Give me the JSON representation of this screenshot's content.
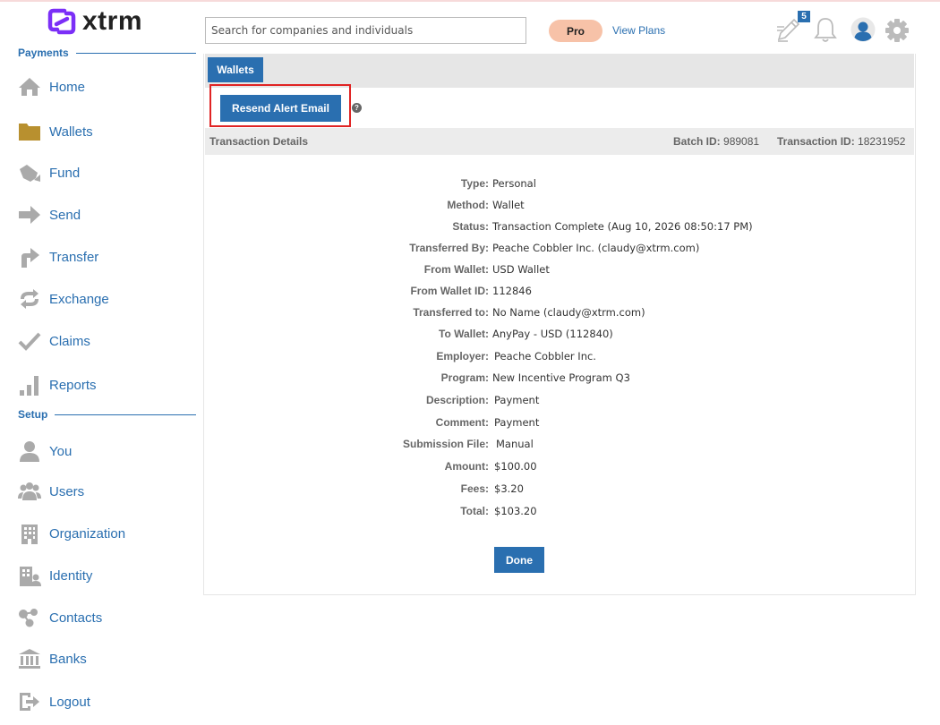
{
  "app": {
    "brand": "xtrm",
    "brand_color": "#7b2ff7",
    "accent_color": "#2a6fb0"
  },
  "header": {
    "search_placeholder": "Search for companies and individuals",
    "pro_label": "Pro",
    "view_plans_label": "View Plans",
    "tasks_count": "5",
    "icons": [
      "edit-tasks-icon",
      "bell-icon",
      "user-avatar-icon",
      "gear-icon"
    ]
  },
  "sidebar": {
    "payments_heading": "Payments",
    "setup_heading": "Setup",
    "payments_items": [
      {
        "label": "Home",
        "icon": "home-icon"
      },
      {
        "label": "Wallets",
        "icon": "folder-icon"
      },
      {
        "label": "Fund",
        "icon": "fund-icon"
      },
      {
        "label": "Send",
        "icon": "send-arrow-icon"
      },
      {
        "label": "Transfer",
        "icon": "transfer-arrow-icon"
      },
      {
        "label": "Exchange",
        "icon": "exchange-icon"
      },
      {
        "label": "Claims",
        "icon": "checkmark-icon"
      },
      {
        "label": "Reports",
        "icon": "bar-chart-icon"
      }
    ],
    "setup_items": [
      {
        "label": "You",
        "icon": "person-icon"
      },
      {
        "label": "Users",
        "icon": "users-icon"
      },
      {
        "label": "Organization",
        "icon": "building-icon"
      },
      {
        "label": "Identity",
        "icon": "identity-icon"
      },
      {
        "label": "Contacts",
        "icon": "contacts-icon"
      },
      {
        "label": "Banks",
        "icon": "bank-icon"
      },
      {
        "label": "Logout",
        "icon": "logout-icon"
      }
    ]
  },
  "main": {
    "tab_label": "Wallets",
    "resend_button_label": "Resend Alert Email",
    "help_icon_glyph": "?",
    "details_title": "Transaction Details",
    "batch_label": "Batch ID:",
    "batch_value": "989081",
    "transaction_label": "Transaction ID:",
    "transaction_value": "18231952",
    "details": [
      {
        "key": "Type:",
        "value": "Personal"
      },
      {
        "key": "Method:",
        "value": "Wallet"
      },
      {
        "key": "Status:",
        "value": "Transaction Complete (Aug 10, 2026 08:50:17 PM)"
      },
      {
        "key": "Transferred By:",
        "value": "Peache Cobbler Inc. (claudy@xtrm.com)"
      },
      {
        "key": "From Wallet:",
        "value": "USD Wallet"
      },
      {
        "key": "From Wallet ID:",
        "value": "112846"
      },
      {
        "key": "Transferred to:",
        "value": "No Name (claudy@xtrm.com)"
      },
      {
        "key": "To Wallet:",
        "value": "AnyPay - USD (112840)"
      },
      {
        "key": "Employer:",
        "value": "Peache Cobbler Inc."
      },
      {
        "key": "Program:",
        "value": "New Incentive Program Q3"
      },
      {
        "key": "Description:",
        "value": "Payment"
      },
      {
        "key": "Comment:",
        "value": "Payment"
      },
      {
        "key": "Submission File:",
        "value": "Manual"
      },
      {
        "key": "Amount:",
        "value": "$100.00"
      },
      {
        "key": "Fees:",
        "value": "$3.20"
      },
      {
        "key": "Total:",
        "value": "$103.20"
      }
    ],
    "done_label": "Done"
  }
}
